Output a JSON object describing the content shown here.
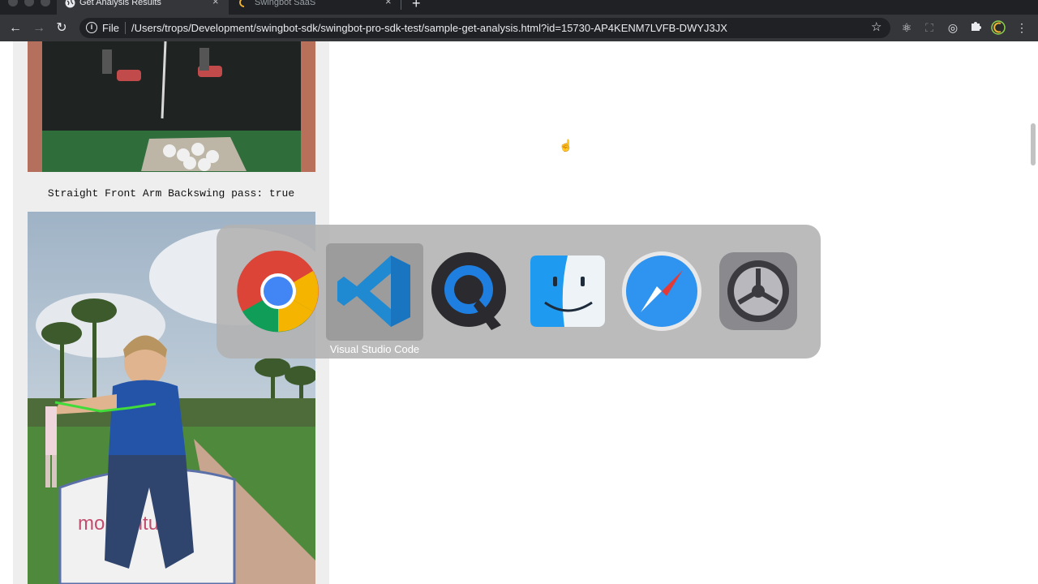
{
  "browser": {
    "tabs": [
      {
        "title": "Get Analysis Results",
        "active": true
      },
      {
        "title": "Swingbot SaaS",
        "active": false
      }
    ],
    "new_tab_symbol": "+",
    "close_symbol": "×",
    "nav": {
      "back": "←",
      "forward": "→",
      "reload": "↻"
    },
    "omnibox": {
      "scheme_label": "File",
      "url": "/Users/trops/Development/swingbot-sdk/swingbot-pro-sdk-test/sample-get-analysis.html?id=15730-AP4KENM7LVFB-DWYJ3JX"
    },
    "icons": {
      "star": "star-icon",
      "extensions": [
        "react-icon",
        "screen-capture-icon",
        "target-icon",
        "puzzle-icon",
        "profile-icon",
        "menu-icon"
      ]
    }
  },
  "page": {
    "result_text": "Straight Front Arm Backswing pass: true",
    "banner_text": "momentum"
  },
  "app_switcher": {
    "apps": [
      "Google Chrome",
      "Visual Studio Code",
      "QuickTime Player",
      "Finder",
      "Safari",
      "System Preferences"
    ],
    "selected_label": "Visual Studio Code"
  },
  "colors": {
    "chrome_dark": "#202124",
    "toolbar": "#35363a",
    "panel_bg": "#eeeeee",
    "swing_line": "#3fdc3a"
  }
}
